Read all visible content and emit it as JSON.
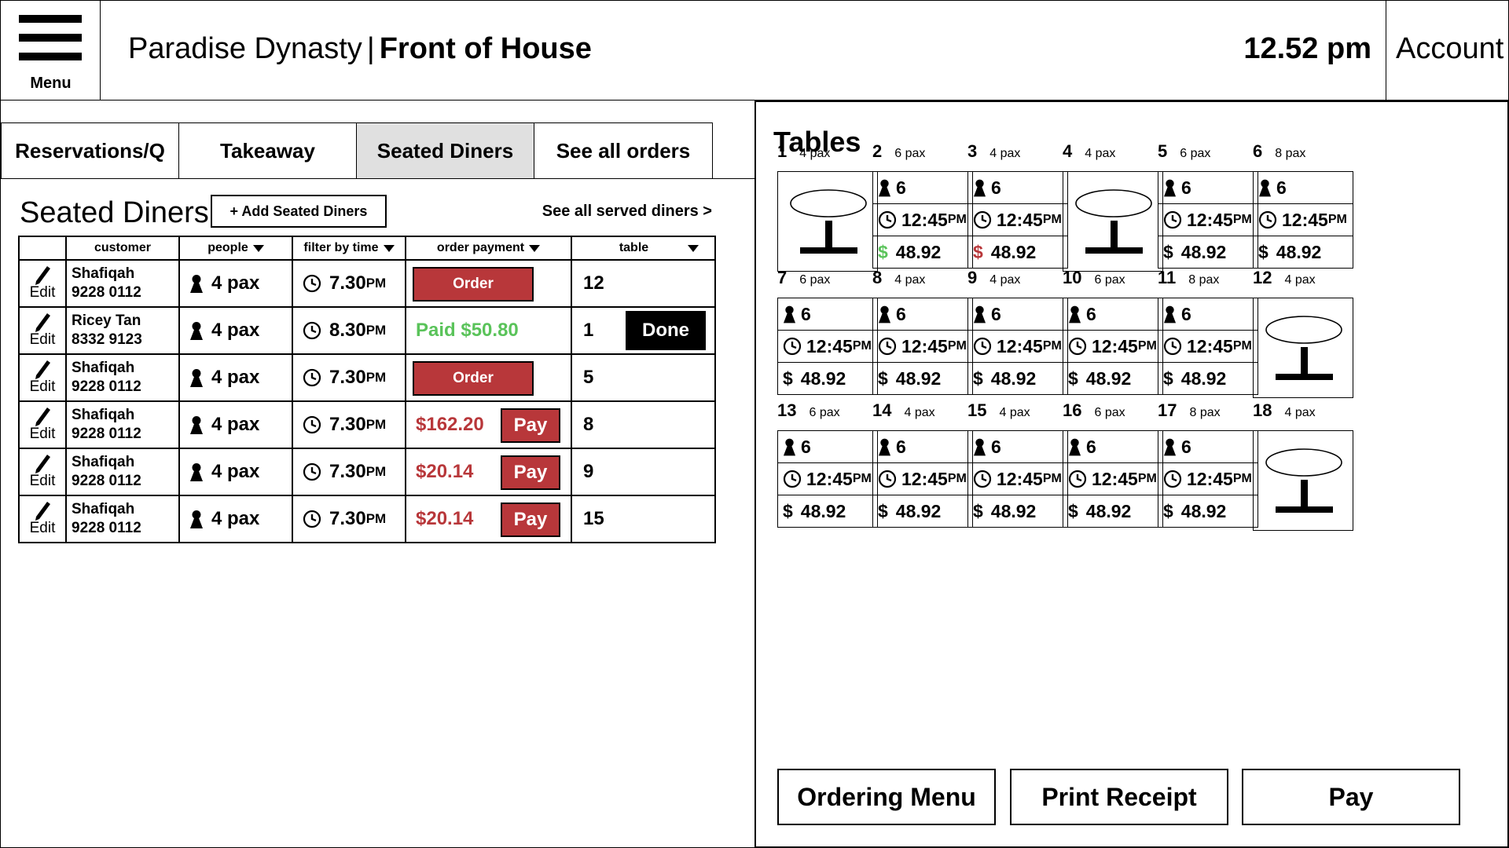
{
  "header": {
    "menu_label": "Menu",
    "brand": "Paradise Dynasty",
    "separator": "|",
    "section": "Front of House",
    "time": "12.52 pm",
    "account_label": "Account"
  },
  "tabs": [
    {
      "label": "Reservations/Q",
      "active": false
    },
    {
      "label": "Takeaway",
      "active": false
    },
    {
      "label": "Seated Diners",
      "active": true
    },
    {
      "label": "See all orders",
      "active": false
    }
  ],
  "seated": {
    "title": "Seated Diners",
    "add_label": "+ Add Seated Diners",
    "see_served": "See all served diners >",
    "columns": {
      "customer": "customer",
      "people": "people",
      "time": "filter by time",
      "payment": "order payment",
      "table": "table"
    },
    "edit_label": "Edit",
    "rows": [
      {
        "name": "Shafiqah",
        "phone": "9228 0112",
        "pax": "4 pax",
        "time": "7.30",
        "ampm": "PM",
        "payment_type": "order",
        "payment_text": "Order",
        "table": "12"
      },
      {
        "name": "Ricey Tan",
        "phone": "8332 9123",
        "pax": "4 pax",
        "time": "8.30",
        "ampm": "PM",
        "payment_type": "paid",
        "payment_text": "Paid $50.80",
        "table": "1",
        "done_label": "Done"
      },
      {
        "name": "Shafiqah",
        "phone": "9228 0112",
        "pax": "4 pax",
        "time": "7.30",
        "ampm": "PM",
        "payment_type": "order",
        "payment_text": "Order",
        "table": "5"
      },
      {
        "name": "Shafiqah",
        "phone": "9228 0112",
        "pax": "4 pax",
        "time": "7.30",
        "ampm": "PM",
        "payment_type": "due",
        "payment_text": "$162.20",
        "pay_label": "Pay",
        "table": "8"
      },
      {
        "name": "Shafiqah",
        "phone": "9228 0112",
        "pax": "4 pax",
        "time": "7.30",
        "ampm": "PM",
        "payment_type": "due",
        "payment_text": "$20.14",
        "pay_label": "Pay",
        "table": "9"
      },
      {
        "name": "Shafiqah",
        "phone": "9228 0112",
        "pax": "4 pax",
        "time": "7.30",
        "ampm": "PM",
        "payment_type": "due",
        "payment_text": "$20.14",
        "pay_label": "Pay",
        "table": "15"
      }
    ]
  },
  "tables_panel": {
    "title": "Tables",
    "tables": [
      {
        "num": "1",
        "pax": "4 pax",
        "status": "empty"
      },
      {
        "num": "2",
        "pax": "6 pax",
        "status": "occupied",
        "guests": "6",
        "time": "12:45",
        "ampm": "PM",
        "amount": "48.92",
        "money_color": "green"
      },
      {
        "num": "3",
        "pax": "4 pax",
        "status": "occupied",
        "guests": "6",
        "time": "12:45",
        "ampm": "PM",
        "amount": "48.92",
        "money_color": "red"
      },
      {
        "num": "4",
        "pax": "4 pax",
        "status": "empty"
      },
      {
        "num": "5",
        "pax": "6 pax",
        "status": "occupied",
        "guests": "6",
        "time": "12:45",
        "ampm": "PM",
        "amount": "48.92",
        "money_color": "black"
      },
      {
        "num": "6",
        "pax": "8 pax",
        "status": "occupied",
        "guests": "6",
        "time": "12:45",
        "ampm": "PM",
        "amount": "48.92",
        "money_color": "black"
      },
      {
        "num": "7",
        "pax": "6 pax",
        "status": "occupied",
        "guests": "6",
        "time": "12:45",
        "ampm": "PM",
        "amount": "48.92",
        "money_color": "black"
      },
      {
        "num": "8",
        "pax": "4 pax",
        "status": "occupied",
        "guests": "6",
        "time": "12:45",
        "ampm": "PM",
        "amount": "48.92",
        "money_color": "black"
      },
      {
        "num": "9",
        "pax": "4 pax",
        "status": "occupied",
        "guests": "6",
        "time": "12:45",
        "ampm": "PM",
        "amount": "48.92",
        "money_color": "black"
      },
      {
        "num": "10",
        "pax": "6 pax",
        "status": "occupied",
        "guests": "6",
        "time": "12:45",
        "ampm": "PM",
        "amount": "48.92",
        "money_color": "black"
      },
      {
        "num": "11",
        "pax": "8 pax",
        "status": "occupied",
        "guests": "6",
        "time": "12:45",
        "ampm": "PM",
        "amount": "48.92",
        "money_color": "black"
      },
      {
        "num": "12",
        "pax": "4 pax",
        "status": "empty"
      },
      {
        "num": "13",
        "pax": "6 pax",
        "status": "occupied",
        "guests": "6",
        "time": "12:45",
        "ampm": "PM",
        "amount": "48.92",
        "money_color": "black"
      },
      {
        "num": "14",
        "pax": "4 pax",
        "status": "occupied",
        "guests": "6",
        "time": "12:45",
        "ampm": "PM",
        "amount": "48.92",
        "money_color": "black"
      },
      {
        "num": "15",
        "pax": "4 pax",
        "status": "occupied",
        "guests": "6",
        "time": "12:45",
        "ampm": "PM",
        "amount": "48.92",
        "money_color": "black"
      },
      {
        "num": "16",
        "pax": "6 pax",
        "status": "occupied",
        "guests": "6",
        "time": "12:45",
        "ampm": "PM",
        "amount": "48.92",
        "money_color": "black"
      },
      {
        "num": "17",
        "pax": "8 pax",
        "status": "occupied",
        "guests": "6",
        "time": "12:45",
        "ampm": "PM",
        "amount": "48.92",
        "money_color": "black"
      },
      {
        "num": "18",
        "pax": "4 pax",
        "status": "empty"
      }
    ],
    "currency_symbol": "$",
    "actions": {
      "ordering_menu": "Ordering Menu",
      "print_receipt": "Print Receipt",
      "pay": "Pay"
    }
  },
  "colors": {
    "accent_red": "#b8373a",
    "paid_green": "#5ac35a",
    "active_tab": "#e0e0e0"
  }
}
